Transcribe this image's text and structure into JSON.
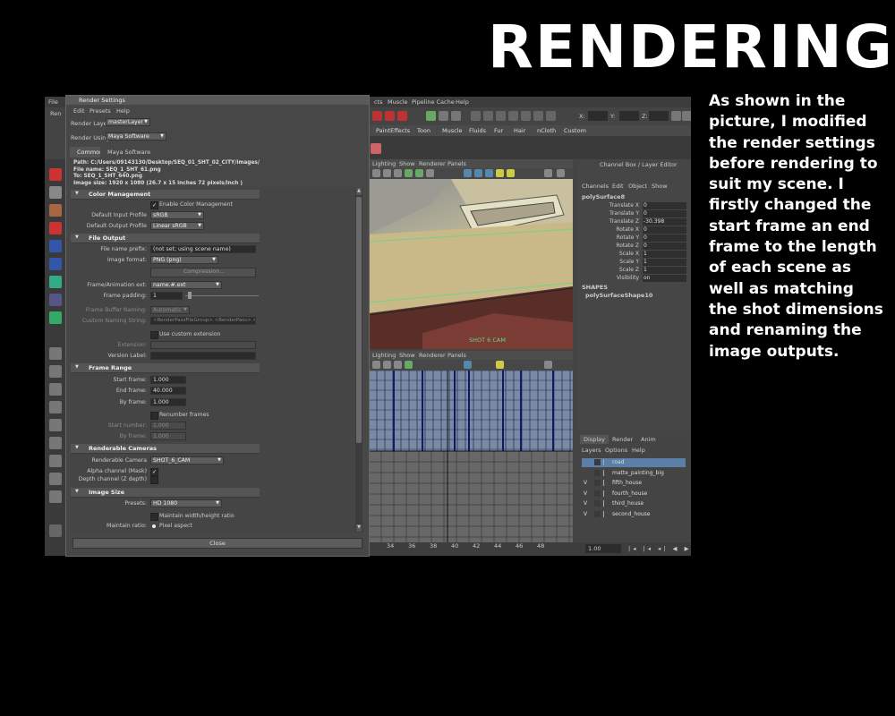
{
  "slide": {
    "title": "RENDERING",
    "body": "As shown in the picture, I modified the render settings before rendering to suit my scene. I firstly changed the start frame an end frame to the length of each scene as well as matching the shot dimensions and renaming the image outputs."
  },
  "maya": {
    "menubar": {
      "file": "File",
      "ren": "Ren",
      "items": [
        "cts",
        "Muscle",
        "Pipeline Cache",
        "Help"
      ]
    },
    "xyz": [
      "X:",
      "Y:",
      "Z:"
    ],
    "shelf_tabs": [
      "PaintEffects",
      "Toon",
      "Muscle",
      "Fluids",
      "Fur",
      "Hair",
      "nCloth",
      "Custom"
    ],
    "viewport_menu": [
      "Lighting",
      "Show",
      "Renderer",
      "Panels"
    ],
    "hud_label": "SHOT 6 CAM",
    "timeline": {
      "ticks": [
        "34",
        "36",
        "38",
        "40",
        "42",
        "44",
        "46",
        "48"
      ],
      "current_frame": "1.00"
    },
    "channel_box": {
      "title": "Channel Box / Layer Editor",
      "menu": [
        "Channels",
        "Edit",
        "Object",
        "Show"
      ],
      "object": "polySurface8",
      "attributes": [
        {
          "label": "Translate X",
          "value": "0"
        },
        {
          "label": "Translate Y",
          "value": "0"
        },
        {
          "label": "Translate Z",
          "value": "-30.398"
        },
        {
          "label": "Rotate X",
          "value": "0"
        },
        {
          "label": "Rotate Y",
          "value": "0"
        },
        {
          "label": "Rotate Z",
          "value": "0"
        },
        {
          "label": "Scale X",
          "value": "1"
        },
        {
          "label": "Scale Y",
          "value": "1"
        },
        {
          "label": "Scale Z",
          "value": "1"
        },
        {
          "label": "Visibility",
          "value": "on"
        }
      ],
      "shapes_label": "SHAPES",
      "shape": "polySurfaceShape10"
    },
    "layer_editor": {
      "tabs": [
        "Display",
        "Render",
        "Anim"
      ],
      "menu": [
        "Layers",
        "Options",
        "Help"
      ],
      "layers": [
        {
          "v": "",
          "name": "road"
        },
        {
          "v": "",
          "name": "matte_painting_big"
        },
        {
          "v": "V",
          "name": "fifth_house"
        },
        {
          "v": "V",
          "name": "fourth_house"
        },
        {
          "v": "V",
          "name": "third_house"
        },
        {
          "v": "V",
          "name": "second_house"
        }
      ]
    }
  },
  "render_settings": {
    "title": "Render Settings",
    "menu": [
      "Edit",
      "Presets",
      "Help"
    ],
    "render_layer_label": "Render Layer",
    "render_layer_value": "masterLayer",
    "render_using_label": "Render Using",
    "render_using_value": "Maya Software",
    "tabs": [
      "Common",
      "Maya Software"
    ],
    "path_info": [
      "Path: C:/Users/09143130/Desktop/SEQ_01_SHT_02_CITY/images/",
      "File name: SEQ_1_SHT_61.png",
      "To:        SEQ_1_SHT_640.png",
      "Image size: 1920 x 1080 (26.7 x 15 inches 72 pixels/inch )"
    ],
    "color_management": {
      "header": "Color Management",
      "enable_label": "Enable Color Management",
      "input_profile_label": "Default Input Profile",
      "input_profile_value": "sRGB",
      "output_profile_label": "Default Output Profile",
      "output_profile_value": "Linear sRGB"
    },
    "file_output": {
      "header": "File Output",
      "prefix_label": "File name prefix:",
      "prefix_value": "(not set; using scene name)",
      "format_label": "Image format:",
      "format_value": "PNG (png)",
      "compression_label": "Compression...",
      "ext_label": "Frame/Animation ext:",
      "ext_value": "name.#.ext",
      "padding_label": "Frame padding:",
      "padding_value": "1",
      "buffer_label": "Frame Buffer Naming:",
      "buffer_value": "Automatic",
      "custom_naming_label": "Custom Naming String:",
      "custom_naming_value": "<RenderPassFileGroup>.<RenderPass>.<Camera>",
      "custom_ext_label": "Use custom extension",
      "extension_label": "Extension:",
      "version_label": "Version Label:"
    },
    "frame_range": {
      "header": "Frame Range",
      "start_label": "Start frame:",
      "start_value": "1.000",
      "end_label": "End frame:",
      "end_value": "40.000",
      "by_label": "By frame:",
      "by_value": "1.000",
      "renumber_label": "Renumber frames",
      "start_number_label": "Start number:",
      "start_number_value": "1.000",
      "by_frame2_label": "By frame:",
      "by_frame2_value": "1.000"
    },
    "renderable_cameras": {
      "header": "Renderable Cameras",
      "camera_label": "Renderable Camera",
      "camera_value": "SHOT_6_CAM",
      "alpha_label": "Alpha channel (Mask)",
      "depth_label": "Depth channel (Z depth)"
    },
    "image_size": {
      "header": "Image Size",
      "presets_label": "Presets:",
      "presets_value": "HD 1080",
      "maintain_wh_label": "Maintain width/height ratio",
      "maintain_ratio_label": "Maintain ratio:",
      "pixel_aspect_label": "Pixel aspect"
    },
    "close_label": "Close"
  }
}
